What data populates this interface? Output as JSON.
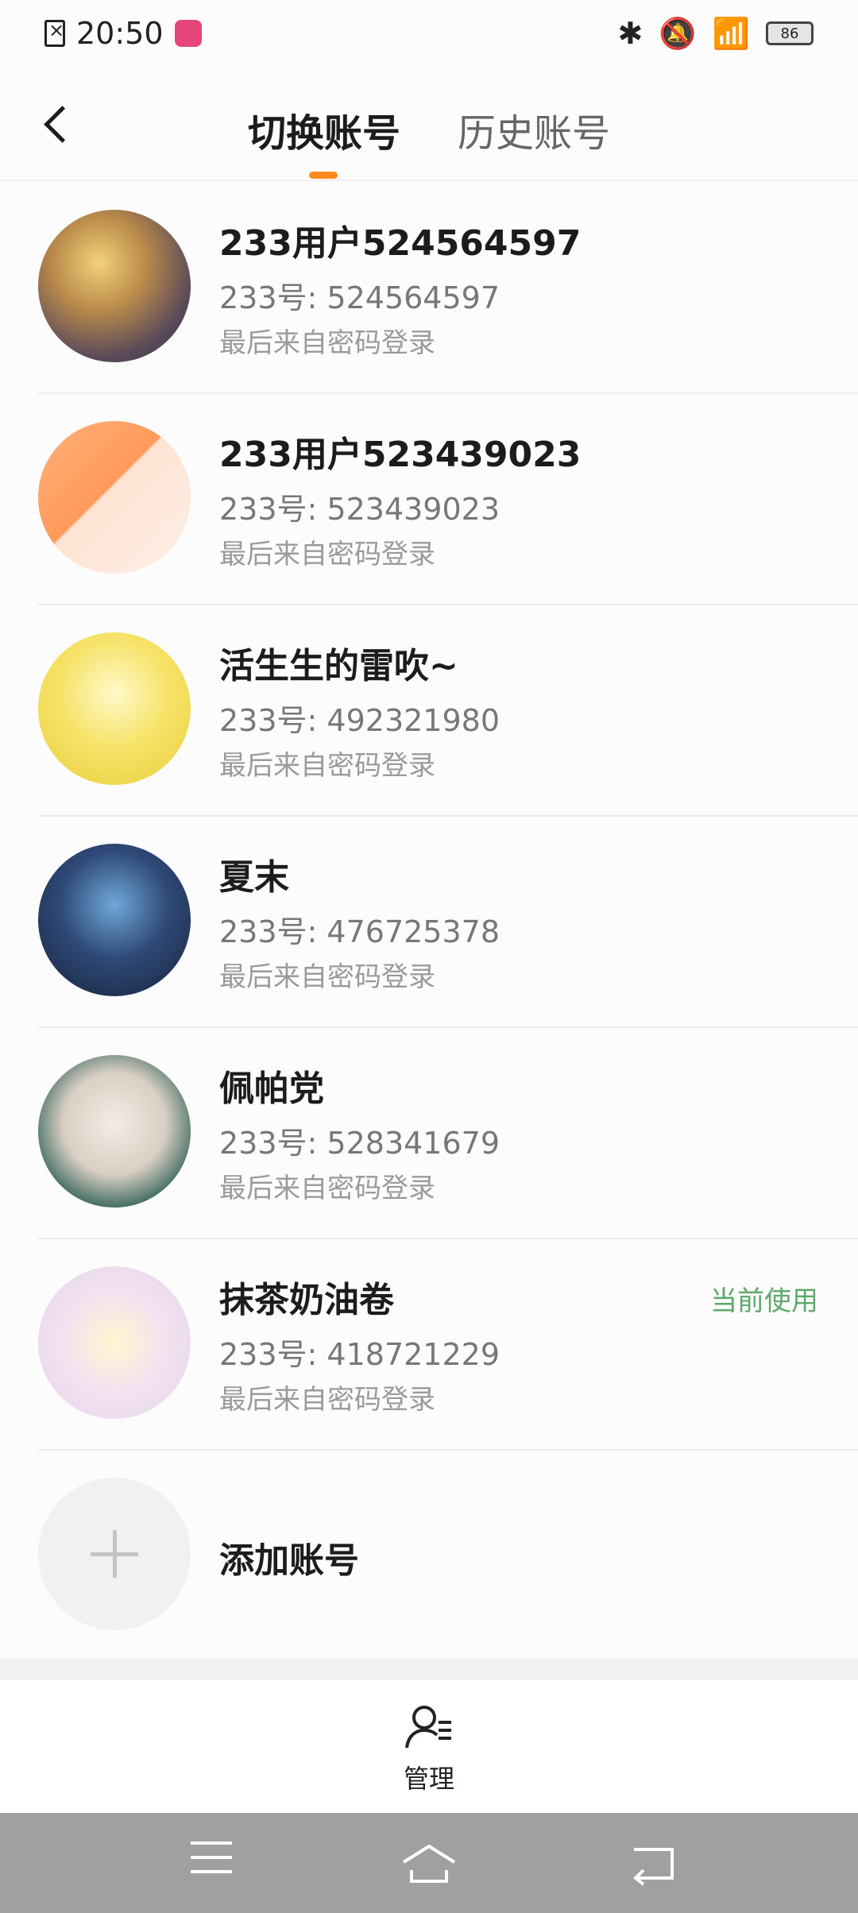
{
  "status": {
    "time": "20:50",
    "battery": "86"
  },
  "header": {
    "tabs": [
      "切换账号",
      "历史账号"
    ]
  },
  "accounts": [
    {
      "name": "233用户524564597",
      "id": "233号: 524564597",
      "login": "最后来自密码登录",
      "current": ""
    },
    {
      "name": "233用户523439023",
      "id": "233号: 523439023",
      "login": "最后来自密码登录",
      "current": ""
    },
    {
      "name": "活生生的雷吹~",
      "id": "233号: 492321980",
      "login": "最后来自密码登录",
      "current": ""
    },
    {
      "name": "夏末",
      "id": "233号: 476725378",
      "login": "最后来自密码登录",
      "current": ""
    },
    {
      "name": "佩帕党",
      "id": "233号: 528341679",
      "login": "最后来自密码登录",
      "current": ""
    },
    {
      "name": "抹茶奶油卷",
      "id": "233号: 418721229",
      "login": "最后来自密码登录",
      "current": "当前使用"
    }
  ],
  "add_account": {
    "label": "添加账号"
  },
  "manage": {
    "label": "管理"
  },
  "colors": {
    "accent": "#ff8a1e",
    "current_green": "#5fa86b"
  }
}
